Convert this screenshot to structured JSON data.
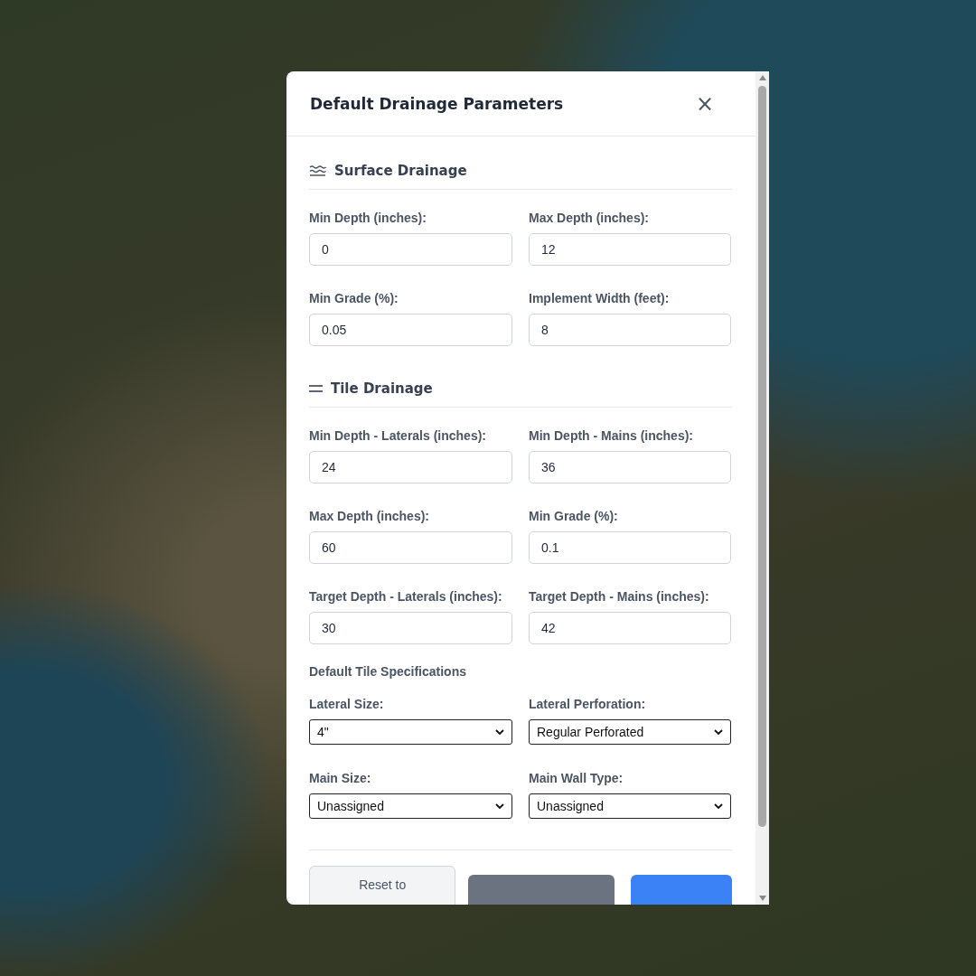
{
  "dialog": {
    "title": "Default Drainage Parameters",
    "close": "×"
  },
  "sections": [
    {
      "kind": "waves",
      "title": "Surface Drainage",
      "fields": [
        {
          "label": "Min Depth (inches):",
          "value": "0"
        },
        {
          "label": "Max Depth (inches):",
          "value": "12"
        },
        {
          "label": "Min Grade (%):",
          "value": "0.05"
        },
        {
          "label": "Implement Width (feet):",
          "value": "8"
        }
      ]
    },
    {
      "kind": "lines",
      "title": "Tile Drainage",
      "fields": [
        {
          "label": "Min Depth - Laterals (inches):",
          "value": "24"
        },
        {
          "label": "Min Depth - Mains (inches):",
          "value": "36"
        },
        {
          "label": "Max Depth (inches):",
          "value": "60"
        },
        {
          "label": "Min Grade (%):",
          "value": "0.1"
        },
        {
          "label": "Target Depth - Laterals (inches):",
          "value": "30"
        },
        {
          "label": "Target Depth - Mains (inches):",
          "value": "42"
        }
      ]
    }
  ],
  "tile_specs": {
    "title": "Default Tile Specifications",
    "fields": [
      {
        "label": "Lateral Size:",
        "value": "4\""
      },
      {
        "label": "Lateral Perforation:",
        "value": "Regular Perforated"
      },
      {
        "label": "Main Size:",
        "value": "Unassigned"
      },
      {
        "label": "Main Wall Type:",
        "value": "Unassigned"
      }
    ]
  },
  "buttons": [
    {
      "label": "Reset to",
      "kind": "secondary"
    },
    {
      "kind": "neutral"
    },
    {
      "kind": "primary"
    }
  ]
}
